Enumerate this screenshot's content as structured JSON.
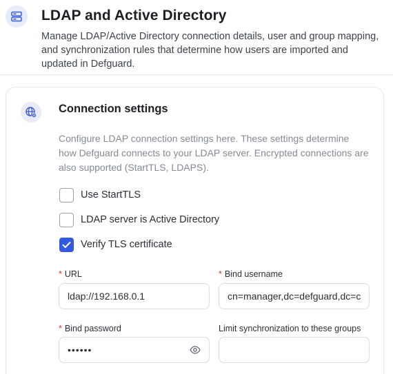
{
  "header": {
    "title": "LDAP and Active Directory",
    "description": "Manage LDAP/Active Directory connection details, user and group mapping, and synchronization rules that determine how users are imported and updated in Defguard.",
    "icon": "server-icon"
  },
  "connection": {
    "title": "Connection settings",
    "icon": "globe-settings-icon",
    "description": "Configure LDAP connection settings here. These settings determine how Defguard connects to your LDAP server. Encrypted connections are also supported (StartTLS, LDAPS).",
    "checkboxes": [
      {
        "label": "Use StartTLS",
        "checked": false
      },
      {
        "label": "LDAP server is Active Directory",
        "checked": false
      },
      {
        "label": "Verify TLS certificate",
        "checked": true
      }
    ],
    "fields": {
      "url": {
        "label": "URL",
        "required": true,
        "value": "ldap://192.168.0.1"
      },
      "bind_username": {
        "label": "Bind username",
        "required": true,
        "value": "cn=manager,dc=defguard,dc=c"
      },
      "bind_password": {
        "label": "Bind password",
        "required": true,
        "value": "••••••"
      },
      "sync_groups": {
        "label": "Limit synchronization to these groups",
        "required": false,
        "value": ""
      }
    },
    "required_marker": "*"
  },
  "colors": {
    "accent": "#3359e0",
    "required": "#d63a2f",
    "icon_badge_bg": "#e8ecf8"
  }
}
